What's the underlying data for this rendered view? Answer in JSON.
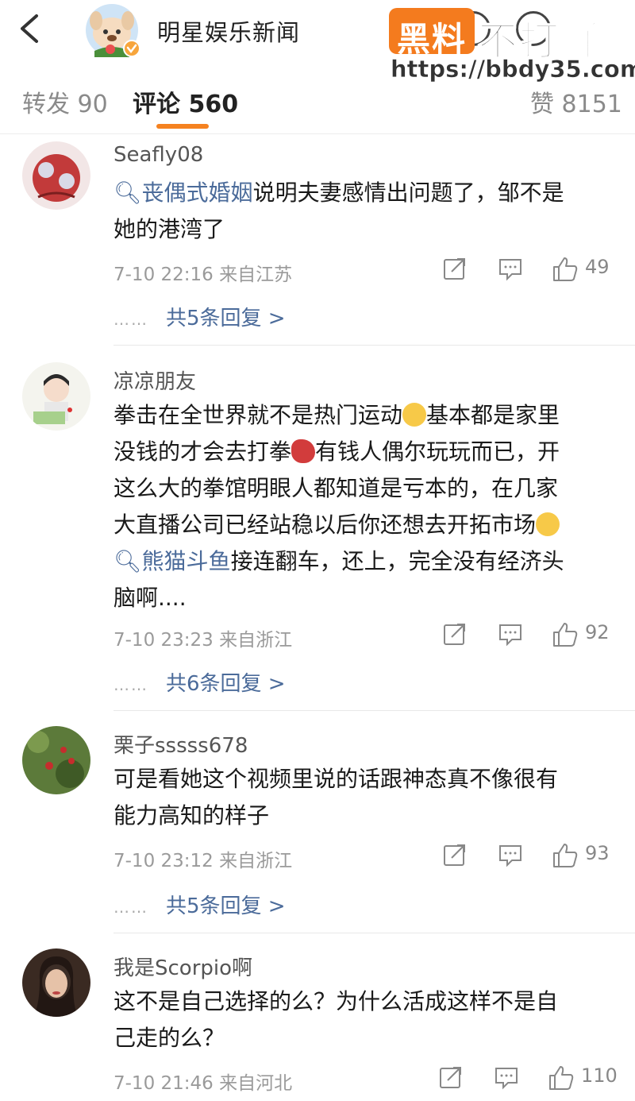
{
  "header": {
    "account_name": "明星娱乐新闻",
    "watermark_badge": "黑料",
    "watermark_text": "不打烊",
    "watermark_url": "https://bbdy35.com"
  },
  "tabs": {
    "repost": "转发 90",
    "comment": "评论 560",
    "likes": "赞 8151"
  },
  "comments": [
    {
      "user": "Seafly08",
      "topic": "丧偶式婚姻",
      "text_line1_rest": "说明夫妻感情出问题了，邹不是",
      "text_line2": "她的港湾了",
      "meta": "7-10 22:16 来自江苏",
      "likes": "49",
      "replies": "共5条回复 >"
    },
    {
      "user": "凉凉朋友",
      "line1": "拳击在全世界就不是热门运动",
      "line1_after": "基本都是家里",
      "line2": "没钱的才会去打拳",
      "line2_after": "有钱人偶尔玩玩而已，开",
      "line3": "这么大的拳馆明眼人都知道是亏本的，在几家",
      "line4": "大直播公司已经站稳以后你还想去开拓市场",
      "topic": "熊猫斗鱼",
      "line5_rest": "接连翻车，还上，完全没有经济头",
      "line6": "脑啊....",
      "meta": "7-10 23:23 来自浙江",
      "likes": "92",
      "replies": "共6条回复 >"
    },
    {
      "user": "栗子sssss678",
      "line1": "可是看她这个视频里说的话跟神态真不像很有",
      "line2": "能力高知的样子",
      "meta": "7-10 23:12 来自浙江",
      "likes": "93",
      "replies": "共5条回复 >"
    },
    {
      "user": "我是Scorpio啊",
      "line1": "这不是自己选择的么？为什么活成这样不是自",
      "line2": "己走的么？",
      "meta": "7-10 21:46 来自河北",
      "likes": "110"
    }
  ],
  "dots": "……",
  "colors": {
    "accent": "#f58220",
    "link": "#4b6b9a"
  }
}
